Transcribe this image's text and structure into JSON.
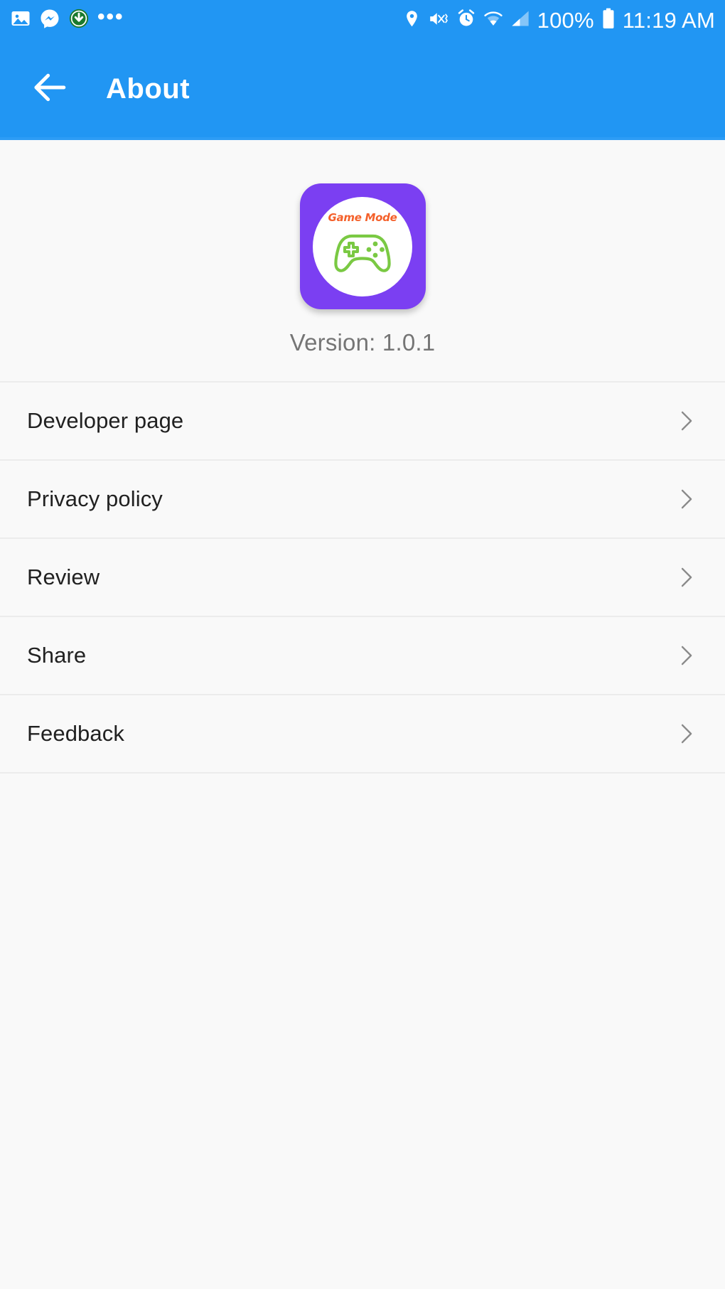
{
  "status_bar": {
    "left_icons": [
      "gallery-image-icon",
      "messenger-icon",
      "download-circle-icon"
    ],
    "overflow": "•••",
    "right_icons": [
      "location-pin-icon",
      "vibrate-mute-icon",
      "alarm-clock-icon",
      "wifi-icon",
      "cellular-signal-icon"
    ],
    "battery_percent": "100%",
    "time": "11:19 AM",
    "background_color": "#2196f3"
  },
  "app_bar": {
    "back_icon": "arrow-left-icon",
    "title": "About",
    "background_color": "#2196f3"
  },
  "logo": {
    "wordmark": "Game Mode",
    "badge_color": "#7B3FF2",
    "wordmark_color": "#F4602A",
    "gamepad_color": "#7AC943",
    "gamepad_icon": "gamepad-icon"
  },
  "version": {
    "label": "Version: 1.0.1"
  },
  "menu": {
    "chevron_icon": "chevron-right-icon",
    "items": [
      {
        "label": "Developer page"
      },
      {
        "label": "Privacy policy"
      },
      {
        "label": "Review"
      },
      {
        "label": "Share"
      },
      {
        "label": "Feedback"
      }
    ]
  }
}
